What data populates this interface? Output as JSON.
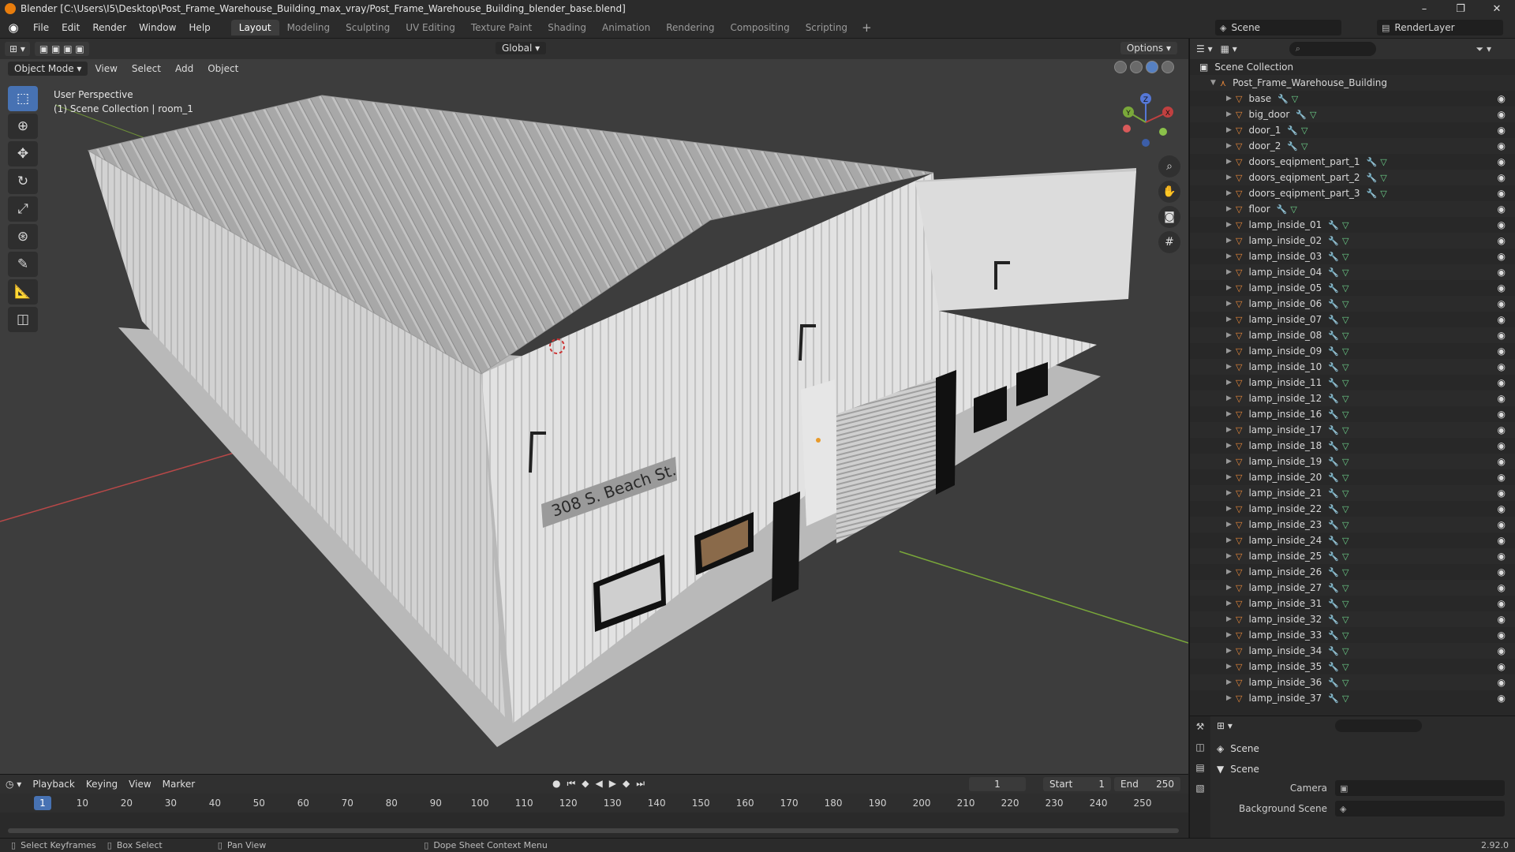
{
  "window": {
    "title": "Blender [C:\\Users\\I5\\Desktop\\Post_Frame_Warehouse_Building_max_vray/Post_Frame_Warehouse_Building_blender_base.blend]",
    "controls": [
      "–",
      "❐",
      "✕"
    ]
  },
  "menubar": {
    "items": [
      "File",
      "Edit",
      "Render",
      "Window",
      "Help"
    ],
    "workspaces": [
      "Layout",
      "Modeling",
      "Sculpting",
      "UV Editing",
      "Texture Paint",
      "Shading",
      "Animation",
      "Rendering",
      "Compositing",
      "Scripting"
    ],
    "active_workspace": "Layout",
    "scene": "Scene",
    "view_layer": "RenderLayer"
  },
  "viewport": {
    "orientation": "Global",
    "options_label": "Options",
    "mode": "Object Mode",
    "menus": [
      "View",
      "Select",
      "Add",
      "Object"
    ],
    "overlay_line1": "User Perspective",
    "overlay_line2": "(1) Scene Collection | room_1",
    "sign_text": "308 S. Beach St.",
    "gizmo_axes": [
      "X",
      "Y",
      "Z"
    ],
    "colors": {
      "background": "#3d3d3d",
      "x_axis": "#c54a4a",
      "y_axis": "#7aa83a",
      "wall": "#d9d9d9",
      "roof": "#a9a9a9",
      "active": "#4772b3"
    },
    "tools": [
      "select-box",
      "cursor",
      "move",
      "rotate",
      "scale",
      "transform",
      "annotate",
      "measure",
      "add-cube"
    ],
    "nav_tools": [
      "zoom",
      "pan",
      "camera",
      "ortho-grid"
    ]
  },
  "outliner": {
    "root": "Scene Collection",
    "collection": "Post_Frame_Warehouse_Building",
    "objects": [
      "base",
      "big_door",
      "door_1",
      "door_2",
      "doors_eqipment_part_1",
      "doors_eqipment_part_2",
      "doors_eqipment_part_3",
      "floor",
      "lamp_inside_01",
      "lamp_inside_02",
      "lamp_inside_03",
      "lamp_inside_04",
      "lamp_inside_05",
      "lamp_inside_06",
      "lamp_inside_07",
      "lamp_inside_08",
      "lamp_inside_09",
      "lamp_inside_10",
      "lamp_inside_11",
      "lamp_inside_12",
      "lamp_inside_16",
      "lamp_inside_17",
      "lamp_inside_18",
      "lamp_inside_19",
      "lamp_inside_20",
      "lamp_inside_21",
      "lamp_inside_22",
      "lamp_inside_23",
      "lamp_inside_24",
      "lamp_inside_25",
      "lamp_inside_26",
      "lamp_inside_27",
      "lamp_inside_31",
      "lamp_inside_32",
      "lamp_inside_33",
      "lamp_inside_34",
      "lamp_inside_35",
      "lamp_inside_36",
      "lamp_inside_37"
    ]
  },
  "properties": {
    "context_title": "Scene",
    "panel_title": "Scene",
    "camera_label": "Camera",
    "background_scene_label": "Background Scene"
  },
  "timeline": {
    "menus": [
      "Playback",
      "Keying",
      "View",
      "Marker"
    ],
    "current_frame": "1",
    "start_label": "Start",
    "start_value": "1",
    "end_label": "End",
    "end_value": "250",
    "ruler_ticks": [
      "1",
      "10",
      "20",
      "30",
      "40",
      "50",
      "60",
      "70",
      "80",
      "90",
      "100",
      "110",
      "120",
      "130",
      "140",
      "150",
      "160",
      "170",
      "180",
      "190",
      "200",
      "210",
      "220",
      "230",
      "240",
      "250"
    ]
  },
  "statusbar": {
    "items": [
      "Select Keyframes",
      "Box Select",
      "Pan View",
      "Dope Sheet Context Menu"
    ],
    "version": "2.92.0"
  }
}
